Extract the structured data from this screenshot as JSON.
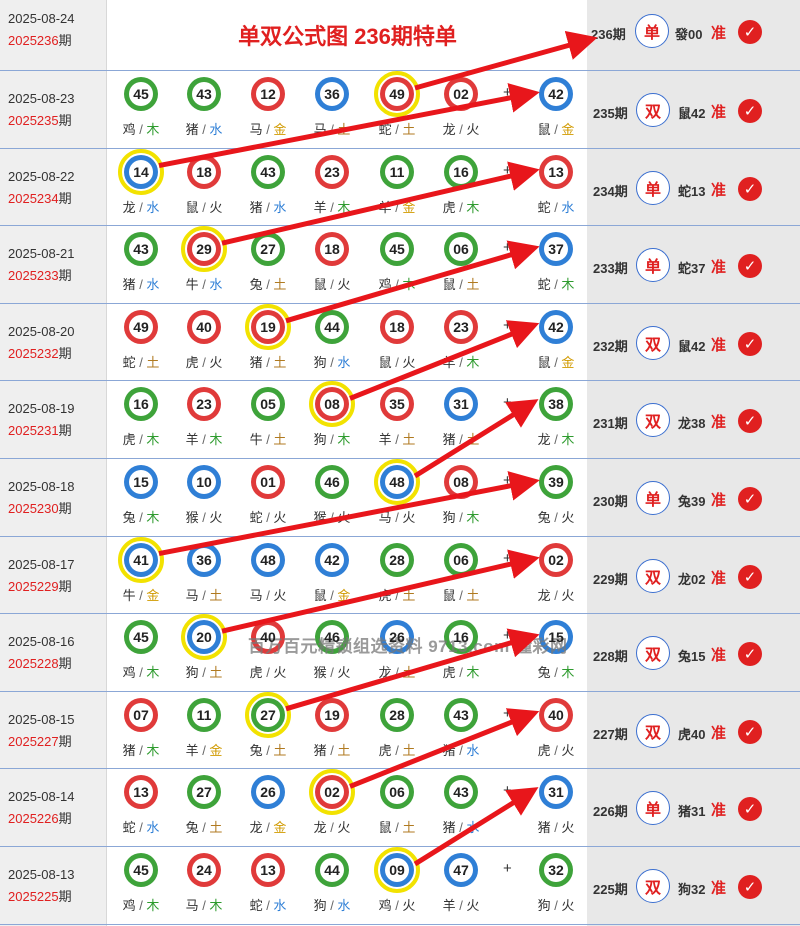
{
  "title": "单双公式图 236期特单",
  "header_row": {
    "date": "2025-08-24",
    "issue": "2025236",
    "issue_suffix": "期",
    "result": {
      "issue": "236期",
      "type": "单",
      "value": "發00",
      "ok": "准"
    }
  },
  "watermark": "百万百元精锁组选资料 9713.com 懂彩网",
  "plus": "+",
  "colors": {
    "red": "#e02020",
    "ring": "#f2e200",
    "row_line": "#8ba7d6",
    "left_bg": "#efefef",
    "right_bg": "#e8e8e8"
  },
  "rows": [
    {
      "date": "2025-08-23",
      "issue": "2025235",
      "issue_suffix": "期",
      "balls": [
        {
          "n": "45",
          "c": "green",
          "z": "鸡",
          "e": "木"
        },
        {
          "n": "43",
          "c": "green",
          "z": "猪",
          "e": "水"
        },
        {
          "n": "12",
          "c": "red",
          "z": "马",
          "e": "金"
        },
        {
          "n": "36",
          "c": "blue",
          "z": "马",
          "e": "土"
        },
        {
          "n": "49",
          "c": "red",
          "z": "蛇",
          "e": "土",
          "hl": true
        },
        {
          "n": "02",
          "c": "red",
          "z": "龙",
          "e": "火"
        },
        {
          "n": "42",
          "c": "blue",
          "z": "鼠",
          "e": "金"
        }
      ],
      "result": {
        "issue": "235期",
        "type": "双",
        "value": "鼠42",
        "ok": "准"
      }
    },
    {
      "date": "2025-08-22",
      "issue": "2025234",
      "issue_suffix": "期",
      "balls": [
        {
          "n": "14",
          "c": "blue",
          "z": "龙",
          "e": "水",
          "hl": true
        },
        {
          "n": "18",
          "c": "red",
          "z": "鼠",
          "e": "火"
        },
        {
          "n": "43",
          "c": "green",
          "z": "猪",
          "e": "水"
        },
        {
          "n": "23",
          "c": "red",
          "z": "羊",
          "e": "木"
        },
        {
          "n": "11",
          "c": "green",
          "z": "羊",
          "e": "金"
        },
        {
          "n": "16",
          "c": "green",
          "z": "虎",
          "e": "木"
        },
        {
          "n": "13",
          "c": "red",
          "z": "蛇",
          "e": "水"
        }
      ],
      "result": {
        "issue": "234期",
        "type": "单",
        "value": "蛇13",
        "ok": "准"
      }
    },
    {
      "date": "2025-08-21",
      "issue": "2025233",
      "issue_suffix": "期",
      "balls": [
        {
          "n": "43",
          "c": "green",
          "z": "猪",
          "e": "水"
        },
        {
          "n": "29",
          "c": "red",
          "z": "牛",
          "e": "水",
          "hl": true
        },
        {
          "n": "27",
          "c": "green",
          "z": "兔",
          "e": "土"
        },
        {
          "n": "18",
          "c": "red",
          "z": "鼠",
          "e": "火"
        },
        {
          "n": "45",
          "c": "green",
          "z": "鸡",
          "e": "木"
        },
        {
          "n": "06",
          "c": "green",
          "z": "鼠",
          "e": "土"
        },
        {
          "n": "37",
          "c": "blue",
          "z": "蛇",
          "e": "木"
        }
      ],
      "result": {
        "issue": "233期",
        "type": "单",
        "value": "蛇37",
        "ok": "准"
      }
    },
    {
      "date": "2025-08-20",
      "issue": "2025232",
      "issue_suffix": "期",
      "balls": [
        {
          "n": "49",
          "c": "red",
          "z": "蛇",
          "e": "土"
        },
        {
          "n": "40",
          "c": "red",
          "z": "虎",
          "e": "火"
        },
        {
          "n": "19",
          "c": "red",
          "z": "猪",
          "e": "土",
          "hl": true
        },
        {
          "n": "44",
          "c": "green",
          "z": "狗",
          "e": "水"
        },
        {
          "n": "18",
          "c": "red",
          "z": "鼠",
          "e": "火"
        },
        {
          "n": "23",
          "c": "red",
          "z": "羊",
          "e": "木"
        },
        {
          "n": "42",
          "c": "blue",
          "z": "鼠",
          "e": "金"
        }
      ],
      "result": {
        "issue": "232期",
        "type": "双",
        "value": "鼠42",
        "ok": "准"
      }
    },
    {
      "date": "2025-08-19",
      "issue": "2025231",
      "issue_suffix": "期",
      "balls": [
        {
          "n": "16",
          "c": "green",
          "z": "虎",
          "e": "木"
        },
        {
          "n": "23",
          "c": "red",
          "z": "羊",
          "e": "木"
        },
        {
          "n": "05",
          "c": "green",
          "z": "牛",
          "e": "土"
        },
        {
          "n": "08",
          "c": "red",
          "z": "狗",
          "e": "木",
          "hl": true
        },
        {
          "n": "35",
          "c": "red",
          "z": "羊",
          "e": "土"
        },
        {
          "n": "31",
          "c": "blue",
          "z": "猪",
          "e": "土"
        },
        {
          "n": "38",
          "c": "green",
          "z": "龙",
          "e": "木"
        }
      ],
      "result": {
        "issue": "231期",
        "type": "双",
        "value": "龙38",
        "ok": "准"
      }
    },
    {
      "date": "2025-08-18",
      "issue": "2025230",
      "issue_suffix": "期",
      "balls": [
        {
          "n": "15",
          "c": "blue",
          "z": "兔",
          "e": "木"
        },
        {
          "n": "10",
          "c": "blue",
          "z": "猴",
          "e": "火"
        },
        {
          "n": "01",
          "c": "red",
          "z": "蛇",
          "e": "火"
        },
        {
          "n": "46",
          "c": "green",
          "z": "猴",
          "e": "火"
        },
        {
          "n": "48",
          "c": "blue",
          "z": "马",
          "e": "火",
          "hl": true
        },
        {
          "n": "08",
          "c": "red",
          "z": "狗",
          "e": "木"
        },
        {
          "n": "39",
          "c": "green",
          "z": "兔",
          "e": "火"
        }
      ],
      "result": {
        "issue": "230期",
        "type": "单",
        "value": "兔39",
        "ok": "准"
      }
    },
    {
      "date": "2025-08-17",
      "issue": "2025229",
      "issue_suffix": "期",
      "balls": [
        {
          "n": "41",
          "c": "blue",
          "z": "牛",
          "e": "金",
          "hl": true
        },
        {
          "n": "36",
          "c": "blue",
          "z": "马",
          "e": "土"
        },
        {
          "n": "48",
          "c": "blue",
          "z": "马",
          "e": "火"
        },
        {
          "n": "42",
          "c": "blue",
          "z": "鼠",
          "e": "金"
        },
        {
          "n": "28",
          "c": "green",
          "z": "虎",
          "e": "土"
        },
        {
          "n": "06",
          "c": "green",
          "z": "鼠",
          "e": "土"
        },
        {
          "n": "02",
          "c": "red",
          "z": "龙",
          "e": "火"
        }
      ],
      "result": {
        "issue": "229期",
        "type": "双",
        "value": "龙02",
        "ok": "准"
      }
    },
    {
      "date": "2025-08-16",
      "issue": "2025228",
      "issue_suffix": "期",
      "balls": [
        {
          "n": "45",
          "c": "green",
          "z": "鸡",
          "e": "木"
        },
        {
          "n": "20",
          "c": "blue",
          "z": "狗",
          "e": "土",
          "hl": true
        },
        {
          "n": "40",
          "c": "red",
          "z": "虎",
          "e": "火"
        },
        {
          "n": "46",
          "c": "green",
          "z": "猴",
          "e": "火"
        },
        {
          "n": "26",
          "c": "blue",
          "z": "龙",
          "e": "土"
        },
        {
          "n": "16",
          "c": "green",
          "z": "虎",
          "e": "木"
        },
        {
          "n": "15",
          "c": "blue",
          "z": "兔",
          "e": "木"
        }
      ],
      "result": {
        "issue": "228期",
        "type": "双",
        "value": "兔15",
        "ok": "准"
      }
    },
    {
      "date": "2025-08-15",
      "issue": "2025227",
      "issue_suffix": "期",
      "balls": [
        {
          "n": "07",
          "c": "red",
          "z": "猪",
          "e": "木"
        },
        {
          "n": "11",
          "c": "green",
          "z": "羊",
          "e": "金"
        },
        {
          "n": "27",
          "c": "green",
          "z": "兔",
          "e": "土",
          "hl": true
        },
        {
          "n": "19",
          "c": "red",
          "z": "猪",
          "e": "土"
        },
        {
          "n": "28",
          "c": "green",
          "z": "虎",
          "e": "土"
        },
        {
          "n": "43",
          "c": "green",
          "z": "猪",
          "e": "水"
        },
        {
          "n": "40",
          "c": "red",
          "z": "虎",
          "e": "火"
        }
      ],
      "result": {
        "issue": "227期",
        "type": "双",
        "value": "虎40",
        "ok": "准"
      }
    },
    {
      "date": "2025-08-14",
      "issue": "2025226",
      "issue_suffix": "期",
      "balls": [
        {
          "n": "13",
          "c": "red",
          "z": "蛇",
          "e": "水"
        },
        {
          "n": "27",
          "c": "green",
          "z": "兔",
          "e": "土"
        },
        {
          "n": "26",
          "c": "blue",
          "z": "龙",
          "e": "金"
        },
        {
          "n": "02",
          "c": "red",
          "z": "龙",
          "e": "火",
          "hl": true
        },
        {
          "n": "06",
          "c": "green",
          "z": "鼠",
          "e": "土"
        },
        {
          "n": "43",
          "c": "green",
          "z": "猪",
          "e": "水"
        },
        {
          "n": "31",
          "c": "blue",
          "z": "猪",
          "e": "火"
        }
      ],
      "result": {
        "issue": "226期",
        "type": "单",
        "value": "猪31",
        "ok": "准"
      }
    },
    {
      "date": "2025-08-13",
      "issue": "2025225",
      "issue_suffix": "期",
      "balls": [
        {
          "n": "45",
          "c": "green",
          "z": "鸡",
          "e": "木"
        },
        {
          "n": "24",
          "c": "red",
          "z": "马",
          "e": "木"
        },
        {
          "n": "13",
          "c": "red",
          "z": "蛇",
          "e": "水"
        },
        {
          "n": "44",
          "c": "green",
          "z": "狗",
          "e": "水"
        },
        {
          "n": "09",
          "c": "blue",
          "z": "鸡",
          "e": "火",
          "hl": true
        },
        {
          "n": "47",
          "c": "blue",
          "z": "羊",
          "e": "火"
        },
        {
          "n": "32",
          "c": "green",
          "z": "狗",
          "e": "火"
        }
      ],
      "result": {
        "issue": "225期",
        "type": "双",
        "value": "狗32",
        "ok": "准"
      }
    }
  ]
}
